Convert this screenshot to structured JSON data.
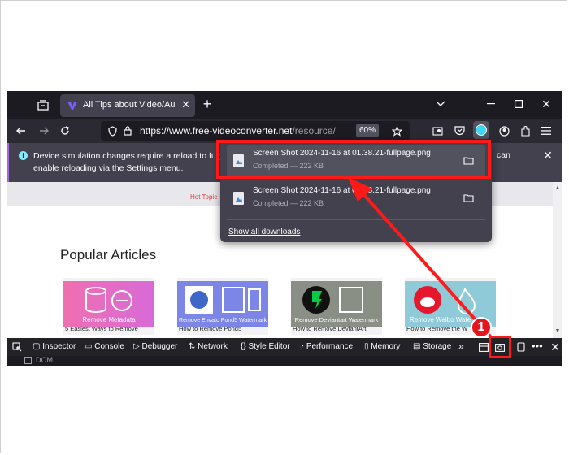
{
  "browser": {
    "tab_title": "All Tips about Video/Audio Converter",
    "url_host": "https://www.free-videoconverter.net",
    "url_path": "/resource/",
    "zoom": "60%"
  },
  "notification": {
    "line1": "Device simulation changes require a reload to fully apply. A",
    "line1_end": "can",
    "line2": "enable reloading via the Settings menu."
  },
  "page": {
    "hot_topics": "Hot Topic",
    "heading": "Popular Articles",
    "cards": [
      {
        "image_label": "Remove Metadata",
        "caption": "5 Easiest Ways to Remove"
      },
      {
        "image_label": "Remove Envato Pond5 Watermark",
        "caption": "How to Remove Pond5"
      },
      {
        "image_label": "Remove Deviantart Watermark",
        "caption": "How to Remove DeviantArt"
      },
      {
        "image_label": "Remove Weibo Wate",
        "caption": "How to Remove the W"
      }
    ]
  },
  "devtools": {
    "inspector": "Inspector",
    "console": "Console",
    "debugger": "Debugger",
    "network": "Network",
    "style_editor": "Style Editor",
    "performance": "Performance",
    "memory": "Memory",
    "storage": "Storage",
    "dom": "DOM"
  },
  "downloads": {
    "items": [
      {
        "name": "Screen Shot 2024-11-16 at 01.38.21-fullpage.png",
        "status": "Completed — 222 KB"
      },
      {
        "name": "Screen Shot 2024-11-16 at 01.38.21-fullpage.png",
        "status": "Completed — 222 KB"
      }
    ],
    "show_all": "Show all downloads"
  },
  "annotation": {
    "badge": "1",
    "color": "#ff1a1a"
  }
}
